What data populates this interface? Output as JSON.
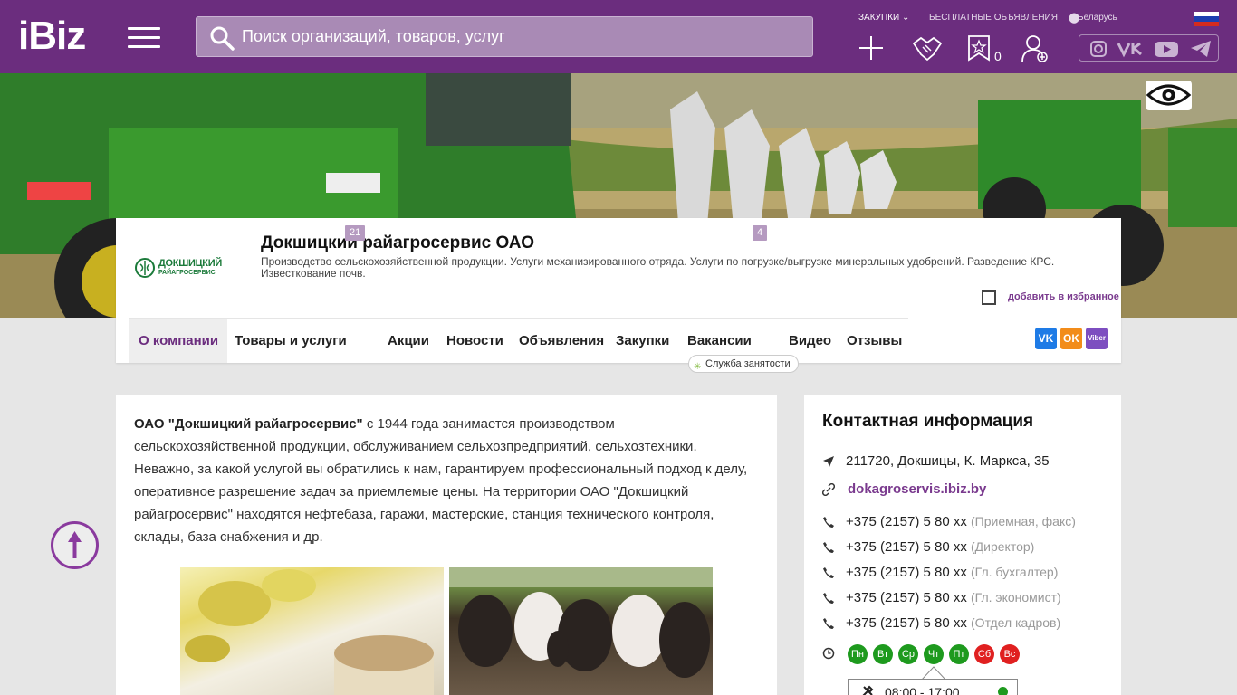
{
  "header": {
    "logo": "iBiz",
    "search_placeholder": "Поиск организаций, товаров, услуг",
    "link_purchases": "ЗАКУПКИ",
    "link_free_ads": "БЕСПЛАТНЫЕ ОБЪЯВЛЕНИЯ",
    "region": "Беларусь",
    "favorites_count": "0",
    "icons": [
      "plus-icon",
      "handshake-icon",
      "favorites-icon",
      "add-user-icon"
    ],
    "social": [
      "instagram-icon",
      "vk-icon",
      "youtube-icon",
      "telegram-icon"
    ]
  },
  "company": {
    "logo_text": "ДОКШИЦКИЙ",
    "logo_subtext": "РАЙАГРОСЕРВИС",
    "name": "Докшицкий райагросервис ОАО",
    "description": "Производство сельскохозяйственной продукции. Услуги механизированного отряда. Услуги по погрузке/выгрузке минеральных удобрений. Разведение КРС. Известкование почв.",
    "add_favorite": "добавить в избранное"
  },
  "tabs": [
    {
      "label": "О компании"
    },
    {
      "label": "Товары и услуги",
      "badge": "21"
    },
    {
      "label": "Акции"
    },
    {
      "label": "Новости"
    },
    {
      "label": "Объявления"
    },
    {
      "label": "Закупки"
    },
    {
      "label": "Вакансии",
      "badge": "4"
    },
    {
      "label": "Видео"
    },
    {
      "label": "Отзывы"
    }
  ],
  "employment_chip": "Служба занятости",
  "share": {
    "vk": "VK",
    "ok": "OK",
    "viber": "Viber"
  },
  "about": {
    "company_bold": "ОАО \"Докшицкий райагросервис\"",
    "text": " с 1944 года занимается производством сельскохозяйственной продукции, обслуживанием сельхозпредприятий, сельхозтехники. Неважно, за какой услугой вы обратились к нам, гарантируем профессиональный подход к делу, оперативное разрешение задач за приемлемые цены. На территории ОАО \"Докшицкий райагросервис\" находятся нефтебаза, гаражи, мастерские, станция технического контроля, склады, база снабжения и др."
  },
  "contacts": {
    "title": "Контактная информация",
    "address": "211720, Докшицы, К. Маркса, 35",
    "website": "dokagroservis.ibiz.by",
    "phones": [
      {
        "number": "+375 (2157) 5 80 xx",
        "note": "(Приемная, факс)"
      },
      {
        "number": "+375 (2157) 5 80 xx",
        "note": "(Директор)"
      },
      {
        "number": "+375 (2157) 5 80 xx",
        "note": "(Гл. бухгалтер)"
      },
      {
        "number": "+375 (2157) 5 80 xx",
        "note": "(Гл. экономист)"
      },
      {
        "number": "+375 (2157) 5 80 xx",
        "note": "(Отдел кадров)"
      }
    ],
    "days": [
      {
        "label": "Пн",
        "open": true
      },
      {
        "label": "Вт",
        "open": true
      },
      {
        "label": "Ср",
        "open": true
      },
      {
        "label": "Чт",
        "open": true
      },
      {
        "label": "Пт",
        "open": true
      },
      {
        "label": "Сб",
        "open": false
      },
      {
        "label": "Вс",
        "open": false
      }
    ],
    "hours": "08:00 - 17:00"
  },
  "colors": {
    "brand": "#6b2d7e",
    "accent": "#7a3a8e",
    "open": "#1e9a1e",
    "closed": "#e02020"
  }
}
